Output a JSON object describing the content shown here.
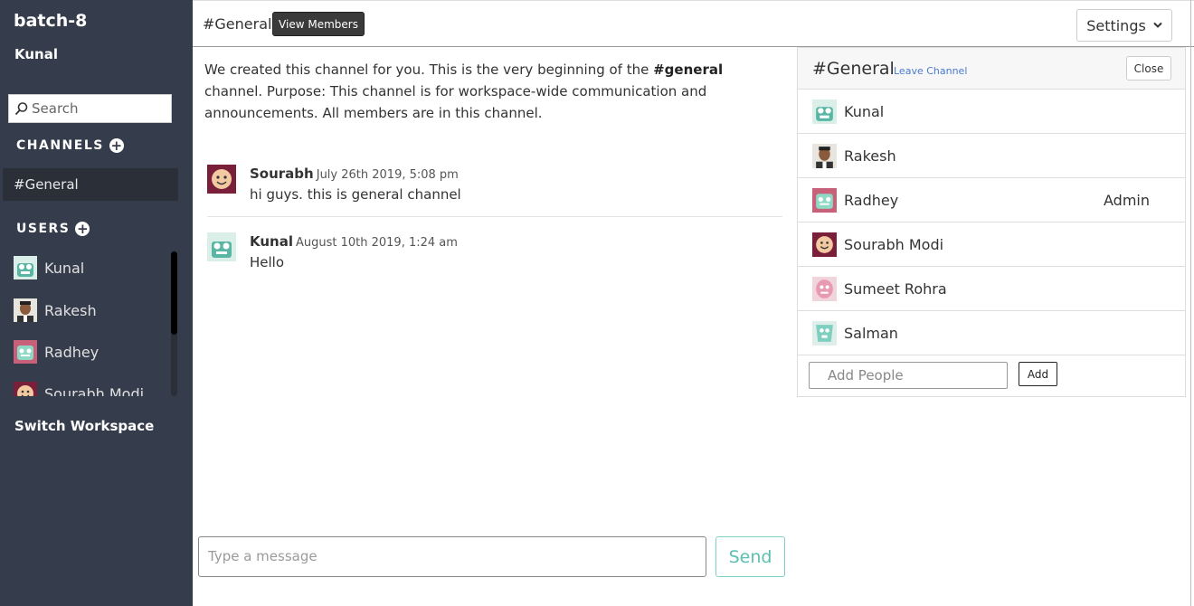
{
  "sidebar": {
    "workspace_name": "batch-8",
    "current_user": "Kunal",
    "search_placeholder": "Search",
    "channels_heading": "CHANNELS",
    "channels": [
      {
        "label": "#General"
      }
    ],
    "users_heading": "USERS",
    "users": [
      {
        "name": "Kunal",
        "avatar": "robot-green-avatar"
      },
      {
        "name": "Rakesh",
        "avatar": "person-photo-avatar"
      },
      {
        "name": "Radhey",
        "avatar": "robot-pink-avatar"
      },
      {
        "name": "Sourabh Modi",
        "avatar": "smiley-avatar"
      }
    ],
    "switch_workspace": "Switch Workspace"
  },
  "header": {
    "channel_title": "#General",
    "view_members_label": "View Members",
    "settings_label": "Settings"
  },
  "intro": {
    "text_before": "We created this channel for you. This is the very beginning of the ",
    "channel_bold": "#general",
    "text_after": " channel. Purpose: This channel is for workspace-wide communication and announcements. All members are in this channel."
  },
  "messages": [
    {
      "author": "Sourabh",
      "time": "July 26th 2019, 5:08 pm",
      "text": "hi guys. this is general channel"
    },
    {
      "author": "Kunal",
      "time": "August 10th 2019, 1:24 am",
      "text": "Hello"
    }
  ],
  "composer": {
    "placeholder": "Type a message",
    "send_label": "Send"
  },
  "members_panel": {
    "title": "#General",
    "leave_label": "Leave Channel",
    "close_label": "Close",
    "members": [
      {
        "name": "Kunal",
        "role": ""
      },
      {
        "name": "Rakesh",
        "role": ""
      },
      {
        "name": "Radhey",
        "role": "Admin"
      },
      {
        "name": "Sourabh Modi",
        "role": ""
      },
      {
        "name": "Sumeet Rohra",
        "role": ""
      },
      {
        "name": "Salman",
        "role": ""
      }
    ],
    "add_people_placeholder": "Add People",
    "add_label": "Add"
  },
  "colors": {
    "sidebar_bg": "#353c4b",
    "active_channel_bg": "#2b2f38",
    "send_accent": "#5bc0b0",
    "link": "#4a7bd0"
  }
}
